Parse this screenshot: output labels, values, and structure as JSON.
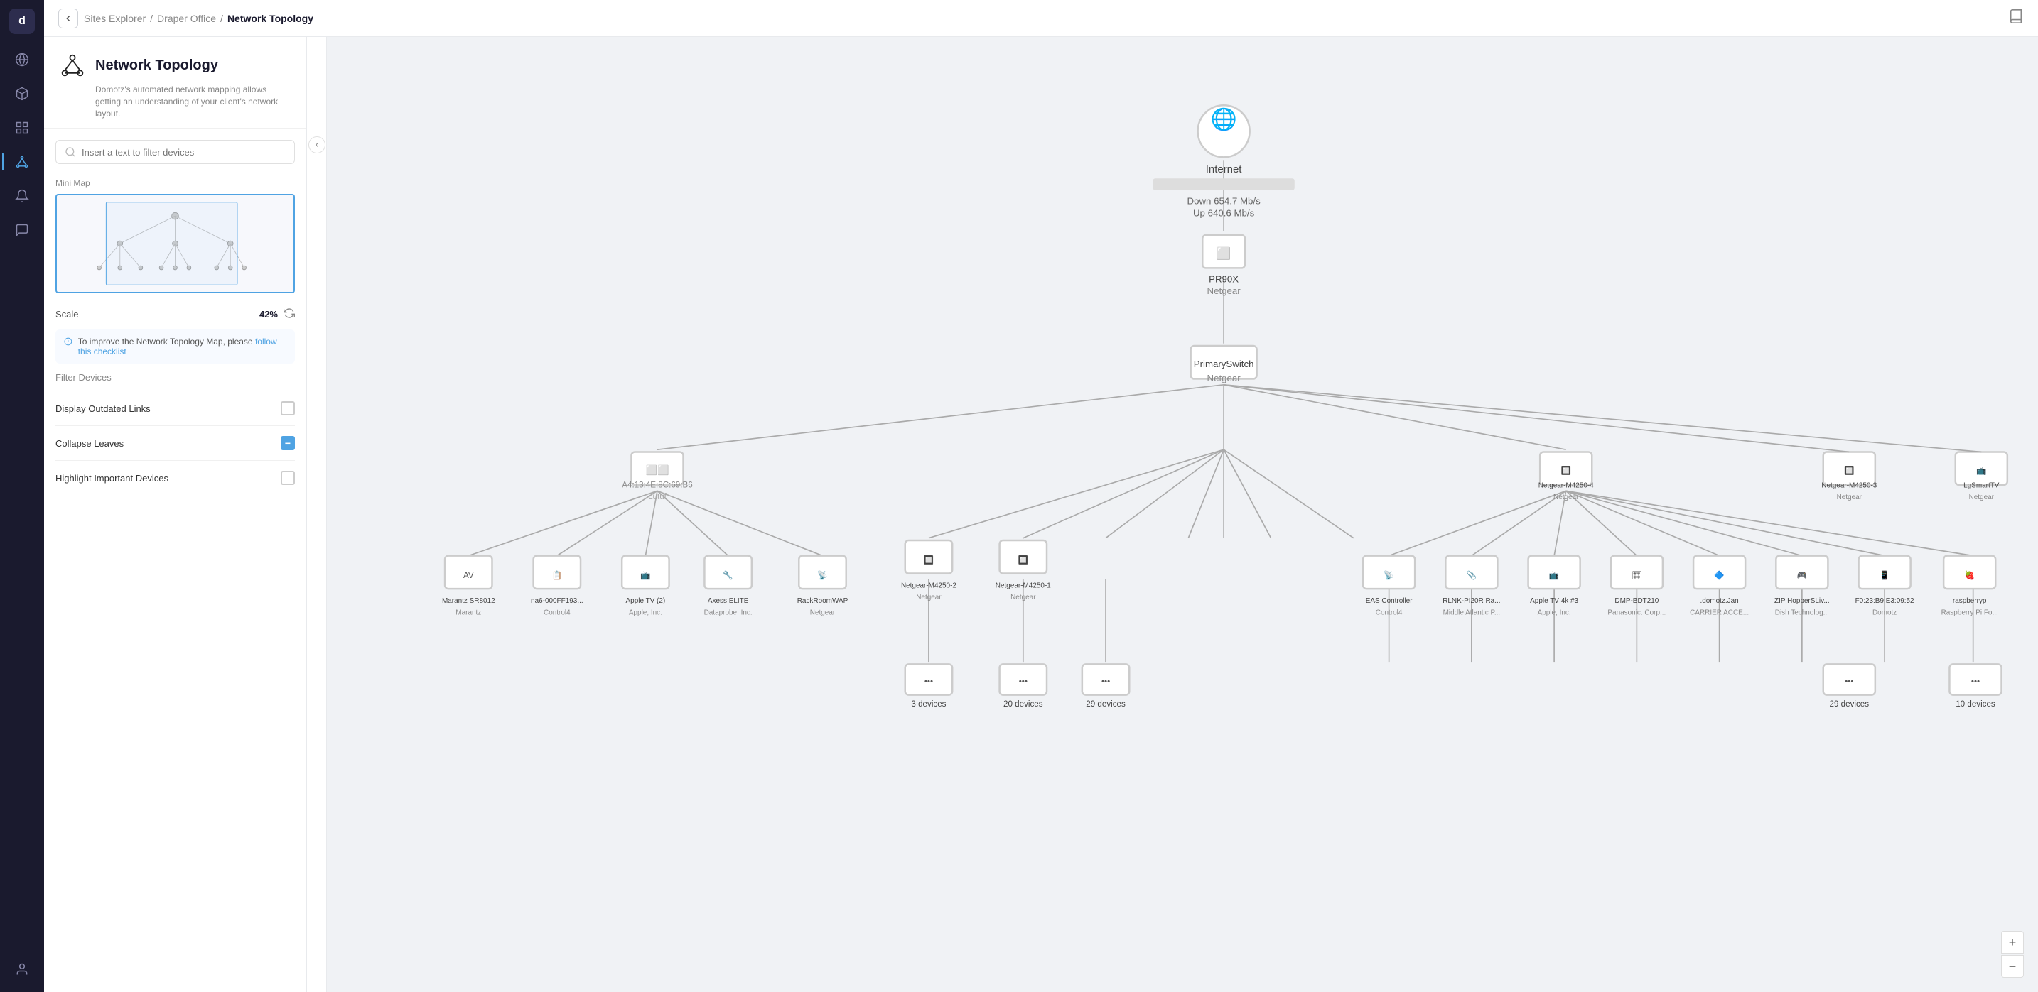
{
  "app": {
    "logo_label": "d"
  },
  "breadcrumb": {
    "back_label": "<",
    "sites_explorer": "Sites Explorer",
    "sep1": "/",
    "draper_office": "Draper Office",
    "sep2": "/",
    "current": "Network Topology"
  },
  "page": {
    "title": "Network Topology",
    "subtitle": "Domotz's automated network mapping allows getting an understanding of your client's network layout."
  },
  "search": {
    "placeholder": "Insert a text to filter devices"
  },
  "mini_map": {
    "label": "Mini Map"
  },
  "scale": {
    "label": "Scale",
    "value": "42%"
  },
  "info_banner": {
    "text": "To improve the Network Topology Map, please ",
    "link_text": "follow this checklist"
  },
  "filter_devices": {
    "label": "Filter Devices",
    "items": [
      {
        "label": "Display Outdated Links",
        "type": "checkbox-empty"
      },
      {
        "label": "Collapse Leaves",
        "type": "checkbox-minus"
      },
      {
        "label": "Highlight Important Devices",
        "type": "checkbox-empty"
      }
    ]
  },
  "sidebar": {
    "items": [
      {
        "name": "globe",
        "active": false
      },
      {
        "name": "cube",
        "active": false
      },
      {
        "name": "list",
        "active": false
      },
      {
        "name": "network",
        "active": true
      },
      {
        "name": "bell",
        "active": false
      },
      {
        "name": "comment",
        "active": false
      },
      {
        "name": "user",
        "active": false
      }
    ]
  },
  "zoom": {
    "plus": "+",
    "minus": "−"
  }
}
